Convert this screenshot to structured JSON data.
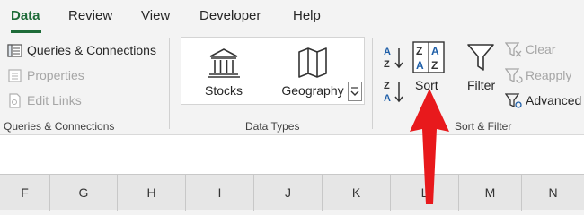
{
  "tabs": [
    {
      "label": "Data",
      "active": true
    },
    {
      "label": "Review",
      "active": false
    },
    {
      "label": "View",
      "active": false
    },
    {
      "label": "Developer",
      "active": false
    },
    {
      "label": "Help",
      "active": false
    }
  ],
  "queries_group": {
    "items": [
      {
        "label": "Queries & Connections",
        "icon": "queries-icon",
        "enabled": true
      },
      {
        "label": "Properties",
        "icon": "properties-icon",
        "enabled": false
      },
      {
        "label": "Edit Links",
        "icon": "edit-links-icon",
        "enabled": false
      }
    ],
    "group_label": "Queries & Connections"
  },
  "data_types_group": {
    "items": [
      {
        "label": "Stocks",
        "icon": "stocks-bank-icon"
      },
      {
        "label": "Geography",
        "icon": "geography-map-icon"
      }
    ],
    "group_label": "Data Types"
  },
  "sort_filter_group": {
    "sort_az_icon": "sort-a-to-z-icon",
    "sort_za_icon": "sort-z-to-a-icon",
    "sort_label": "Sort",
    "filter_label": "Filter",
    "clear_label": "Clear",
    "reapply_label": "Reapply",
    "advanced_label": "Advanced",
    "group_label": "Sort & Filter"
  },
  "columns": [
    "F",
    "G",
    "H",
    "I",
    "J",
    "K",
    "L",
    "M",
    "N"
  ],
  "colors": {
    "accent": "#1e6b38",
    "arrow": "#e8191c"
  }
}
